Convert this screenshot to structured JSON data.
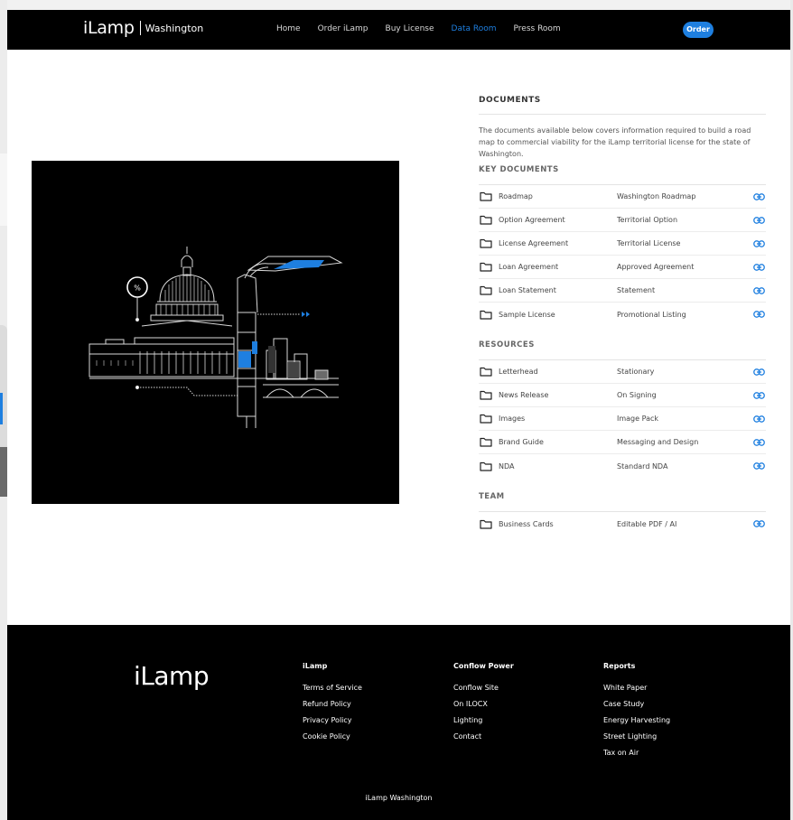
{
  "header": {
    "logo": "iLamp",
    "region": "Washington",
    "nav": [
      "Home",
      "Order iLamp",
      "Buy License",
      "Data Room",
      "Press Room"
    ],
    "active_nav": "Data Room",
    "order_label": "Order"
  },
  "illustration": {
    "badge_text": "%"
  },
  "documents": {
    "title": "DOCUMENTS",
    "description": "The documents available below covers information required to build a road map to commercial viability for the iLamp territorial license for the state of Washington.",
    "sections": [
      {
        "title": "KEY DOCUMENTS",
        "items": [
          {
            "name": "Roadmap",
            "desc": "Washington Roadmap"
          },
          {
            "name": "Option Agreement",
            "desc": "Territorial Option"
          },
          {
            "name": "License Agreement",
            "desc": "Territorial License"
          },
          {
            "name": "Loan Agreement",
            "desc": "Approved Agreement"
          },
          {
            "name": "Loan Statement",
            "desc": "Statement"
          },
          {
            "name": "Sample License",
            "desc": "Promotional Listing"
          }
        ]
      },
      {
        "title": "RESOURCES",
        "items": [
          {
            "name": "Letterhead",
            "desc": "Stationary"
          },
          {
            "name": "News Release",
            "desc": "On Signing"
          },
          {
            "name": "Images",
            "desc": "Image Pack"
          },
          {
            "name": "Brand Guide",
            "desc": "Messaging and Design"
          },
          {
            "name": "NDA",
            "desc": "Standard NDA"
          }
        ]
      },
      {
        "title": "TEAM",
        "items": [
          {
            "name": "Business Cards",
            "desc": "Editable PDF / AI"
          }
        ]
      }
    ],
    "icons": {
      "folder": "folder-icon",
      "link": "link-icon"
    },
    "link_color": "#1e7fe0"
  },
  "footer": {
    "logo": "iLamp",
    "columns": [
      {
        "title": "iLamp",
        "links": [
          "Terms of Service",
          "Refund Policy",
          "Privacy Policy",
          "Cookie Policy"
        ]
      },
      {
        "title": "Conflow Power",
        "links": [
          "Conflow Site",
          "On ILOCX",
          "Lighting",
          "Contact"
        ]
      },
      {
        "title": "Reports",
        "links": [
          "White Paper",
          "Case Study",
          "Energy Harvesting",
          "Street Lighting",
          "Tax on Air"
        ]
      }
    ],
    "copyright": "iLamp Washington"
  },
  "colors": {
    "accent": "#1e7fe0",
    "header_bg": "#000000",
    "footer_bg": "#000000"
  }
}
